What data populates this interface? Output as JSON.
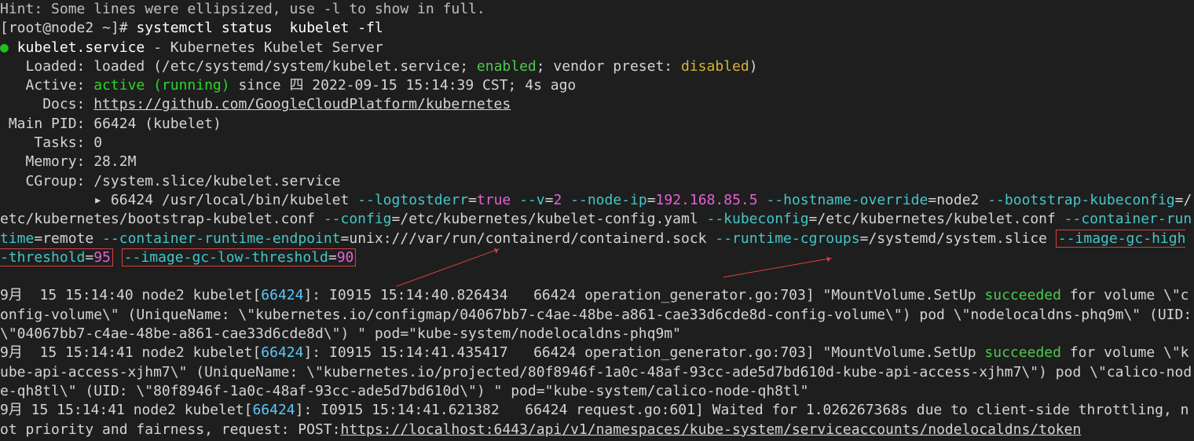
{
  "hint": "Hint: Some lines were ellipsized, use -l to show in full.",
  "prompt": {
    "user": "root",
    "host": "node2",
    "path": "~",
    "symbol": "#",
    "command": "systemctl status  kubelet -fl"
  },
  "service": {
    "name": "kubelet.service",
    "desc": "Kubernetes Kubelet Server",
    "loaded_label": "Loaded:",
    "loaded_value": "loaded (/etc/systemd/system/kubelet.service;",
    "enabled": "enabled",
    "vendor_preset": "; vendor preset: ",
    "disabled": "disabled",
    "loaded_close": ")",
    "active_label": "Active:",
    "active_state": "active (running)",
    "since": " since 四 2022-09-15 15:14:39 CST; 4s ago",
    "docs_label": "Docs:",
    "docs_url": "https://github.com/GoogleCloudPlatform/kubernetes",
    "main_pid_label": "Main PID:",
    "main_pid": "66424 (kubelet)",
    "tasks_label": "Tasks:",
    "tasks": "0",
    "memory_label": "Memory:",
    "memory": "28.2M",
    "cgroup_label": "CGroup:",
    "cgroup": "/system.slice/kubelet.service"
  },
  "cmd": {
    "prefix": "▸ 66424 /usr/local/bin/kubelet ",
    "flag_logtostderr": "--logtostderr",
    "val_true": "true",
    "flag_v": "--v",
    "val_2": "2",
    "flag_node_ip": "--node-ip",
    "val_node_ip": "192.168.85.5",
    "flag_hostname_override": "--hostname-override",
    "val_node2": "node2",
    "flag_bootstrap": "--bootstrap-kubeconfig",
    "val_bootstrap": "/etc/kubernetes/bootstrap-kubelet.conf",
    "flag_config": "--config",
    "val_config": "/etc/kubernetes/kubelet-config.yaml",
    "flag_kubeconfig": "--kubeconfig",
    "val_kubeconfig": "/etc/kubernetes/kubelet.conf",
    "flag_container_runtime": "--container-runtime",
    "val_remote": "remote",
    "flag_container_runtime_endpoint": "--container-runtime-endpoint",
    "val_endpoint": "unix:///var/run/containerd/containerd.sock",
    "flag_runtime_cgroups": "--runtime-cgroups",
    "val_runtime_cgroups": "/systemd/system.slice",
    "flag_gc_high": "--image-gc-high-threshold",
    "val_95": "95",
    "flag_gc_low": "--image-gc-low-threshold",
    "val_90": "90"
  },
  "log1": {
    "ts": "9月  15 15:14:40 node2 kubelet",
    "pid": "66424",
    "body": "]: I0915 15:14:40.826434   66424 operation_generator.go:703] \"MountVolume.SetUp ",
    "succeeded": "succeeded",
    "tail": " for volume \\\"config-volume\\\" (UniqueName: \\\"kubernetes.io/configmap/04067bb7-c4ae-48be-a861-cae33d6cde8d-config-volume\\\") pod \\\"nodelocaldns-phq9m\\\" (UID: \\\"04067bb7-c4ae-48be-a861-cae33d6cde8d\\\") \" pod=\"kube-system/nodelocaldns-phq9m\""
  },
  "log2": {
    "ts": "9月  15 15:14:41 node2 kubelet",
    "pid": "66424",
    "body": "]: I0915 15:14:41.435417   66424 operation_generator.go:703] \"MountVolume.SetUp ",
    "succeeded": "succeeded",
    "tail": " for volume \\\"kube-api-access-xjhm7\\\" (UniqueName: \\\"kubernetes.io/projected/80f8946f-1a0c-48af-93cc-ade5d7bd610d-kube-api-access-xjhm7\\\") pod \\\"calico-node-qh8tl\\\" (UID: \\\"80f8946f-1a0c-48af-93cc-ade5d7bd610d\\\") \" pod=\"kube-system/calico-node-qh8tl\""
  },
  "log3": {
    "ts": "9月 15 15:14:41 node2 kubelet",
    "pid": "66424",
    "body": "]: I0915 15:14:41.621382   66424 request.go:601] Waited for 1.026267368s due to client-side throttling, not priority and fairness, request: POST:",
    "url": "https://localhost:6443/api/v1/namespaces/kube-system/serviceaccounts/nodelocaldns/token"
  }
}
